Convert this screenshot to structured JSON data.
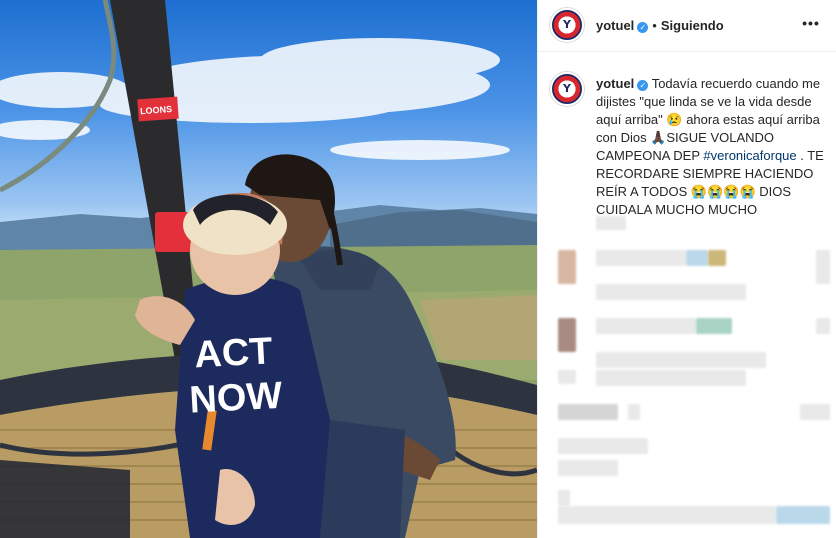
{
  "post": {
    "username": "yotuel",
    "follow_status": "Siguiendo",
    "separator": "•",
    "more_label": "•••",
    "avatar_glyph": "Y",
    "verified_glyph": "✓"
  },
  "caption": {
    "username": "yotuel",
    "text_part1": "Todavía recuerdo cuando me dijistes \"que linda se ve la vida desde aquí arriba\" ",
    "emoji1": "😢",
    "text_part2": " ahora estas aquí arriba con Dios ",
    "emoji2": "🙏🏿",
    "text_part3": "SIGUE VOLANDO CAMPEONA DEP ",
    "hashtag": "#veronicaforque",
    "text_part4": " . TE RECORDARE SIEMPRE HACIENDO REÍR A TODOS ",
    "emoji3": "😭😭😭😭",
    "text_part5": " DIOS CUIDALA MUCHO MUCHO"
  },
  "photo": {
    "shirt_text_line1": "ACT",
    "shirt_text_line2": "NOW",
    "shirt_exclaim": "!",
    "balloon_label": "LOONS"
  },
  "colors": {
    "verified": "#3897f0",
    "hashtag": "#00376b",
    "sky_top": "#1e6fd0",
    "shirt": "#1c2a5e",
    "hoodie": "#3b4a63"
  }
}
